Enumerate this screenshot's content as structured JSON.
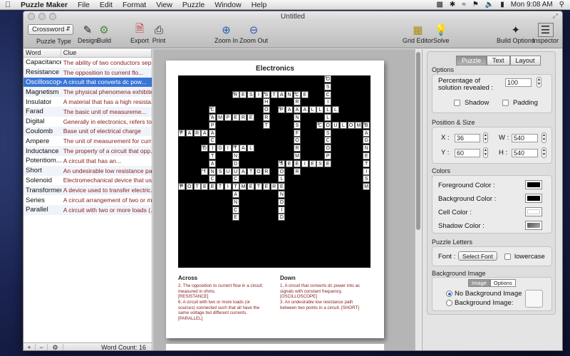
{
  "menubar": {
    "app_name": "Puzzle Maker",
    "items": [
      "File",
      "Edit",
      "Format",
      "View",
      "Puzzle",
      "Window",
      "Help"
    ],
    "clock": "Mon 9:08 AM"
  },
  "window": {
    "title": "Untitled"
  },
  "toolbar": {
    "puzzle_type": "Crossword",
    "puzzle_type_label": "Puzzle Type",
    "design_label": "Design",
    "build_label": "Build",
    "export_label": "Export",
    "print_label": "Print",
    "zoom_in_label": "Zoom In",
    "zoom_out_label": "Zoom Out",
    "grid_editor_label": "Grid Editor",
    "solve_label": "Solve",
    "build_options_label": "Build Options",
    "inspector_label": "Inspector"
  },
  "word_table": {
    "headers": [
      "Word",
      "Clue"
    ],
    "rows": [
      {
        "word": "Capacitance",
        "clue": "The ability of two conductors sep..."
      },
      {
        "word": "Resistance",
        "clue": "The opposition to current flo..."
      },
      {
        "word": "Oscilloscope",
        "clue": "A circuit that converts dc pow..."
      },
      {
        "word": "Magnetism",
        "clue": "The physical phenomena exhibite..."
      },
      {
        "word": "Insulator",
        "clue": "A material that has a high resista..."
      },
      {
        "word": "Farad",
        "clue": "The basic unit of measureme..."
      },
      {
        "word": "Digital",
        "clue": "Generally in electronics, refers to..."
      },
      {
        "word": "Coulomb",
        "clue": "Base unit of electrical charge"
      },
      {
        "word": "Ampere",
        "clue": "The unit of measurement for curr..."
      },
      {
        "word": "Inductance",
        "clue": "The property of a circuit that opp..."
      },
      {
        "word": "Potentiom...",
        "clue": "A circuit that has an..."
      },
      {
        "word": "Short",
        "clue": "An undesirable low resistance pat..."
      },
      {
        "word": "Solenoid",
        "clue": "Electromechanical device that us..."
      },
      {
        "word": "Transformer",
        "clue": "A device used to transfer electric..."
      },
      {
        "word": "Series",
        "clue": "A circuit arrangement of two or m..."
      },
      {
        "word": "Parallel",
        "clue": "A circuit with two or more loads (..."
      }
    ],
    "selected_index": 2,
    "word_count": "Word Count: 16"
  },
  "puzzle_page": {
    "title": "Electronics",
    "across_heading": "Across",
    "down_heading": "Down",
    "across_clues": [
      "2. The opposition to current flow in a circuit; measured in ohms.",
      "[RESISTANCE]",
      "6. A circuit with two or more loads (or sources) connected such that all have the same voltage but different currents.",
      "[PARALLEL]"
    ],
    "down_clues": [
      "1. A circuit that converts dc power into ac signals with constant frequency.",
      "[OSCILLOSCOPE]",
      "3. An undesirable low resistance path between two points in a circuit. [SHORT]"
    ]
  },
  "inspector": {
    "tabs": [
      "Puzzle",
      "Text",
      "Layout"
    ],
    "active_tab": "Puzzle",
    "options_title": "Options",
    "percentage_label": "Percentage of solution revealed :",
    "percentage_value": "100",
    "shadow_label": "Shadow",
    "padding_label": "Padding",
    "position_title": "Position & Size",
    "x_label": "X :",
    "x_value": "36",
    "y_label": "Y :",
    "y_value": "60",
    "w_label": "W :",
    "w_value": "540",
    "h_label": "H :",
    "h_value": "540",
    "colors_title": "Colors",
    "foreground_label": "Foreground Color :",
    "background_label": "Background Color :",
    "cell_label": "Cell Color :",
    "shadow_color_label": "Shadow Color :",
    "colors": {
      "foreground": "#000000",
      "background": "#000000",
      "cell": "#ffffff",
      "shadow": "#808080"
    },
    "letters_title": "Puzzle Letters",
    "font_label": "Font :",
    "select_font_label": "Select Font",
    "lowercase_label": "lowercase",
    "bgimage_title": "Background Image",
    "bg_tabs": [
      "Image",
      "Options"
    ],
    "no_bg_label": "No Background Image",
    "bg_label": "Background Image:"
  }
}
